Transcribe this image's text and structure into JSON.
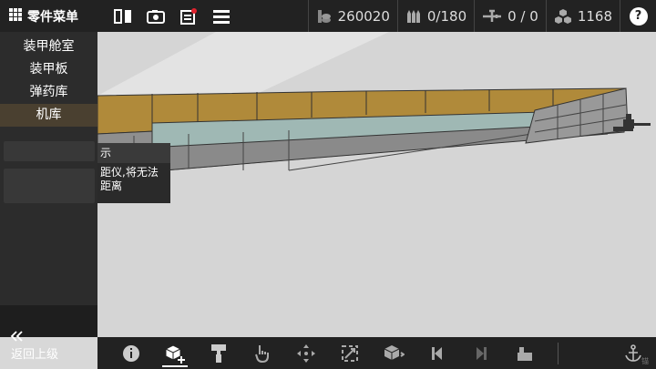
{
  "topbar": {
    "menu_label": "零件菜单",
    "stats": {
      "money": "260020",
      "ammo": "0/180",
      "aircraft": "0 / 0",
      "parts": "1168"
    },
    "help": "?"
  },
  "sidebar": {
    "items": [
      {
        "label": "装甲舱室"
      },
      {
        "label": "装甲板"
      },
      {
        "label": "弹药库"
      },
      {
        "label": "机库"
      }
    ],
    "back_label": "返回上级"
  },
  "tooltip": {
    "title": "示",
    "body_line1": "距仪,将无法",
    "body_line2": "距离"
  },
  "bottombar": {
    "anchor_label": "锚"
  },
  "colors": {
    "accent_deck": "#b08a3a",
    "hull": "#8f8f8f",
    "hull_stripe": "#9fb8b4",
    "topbar": "#222222",
    "panel": "#2c2c2c"
  }
}
